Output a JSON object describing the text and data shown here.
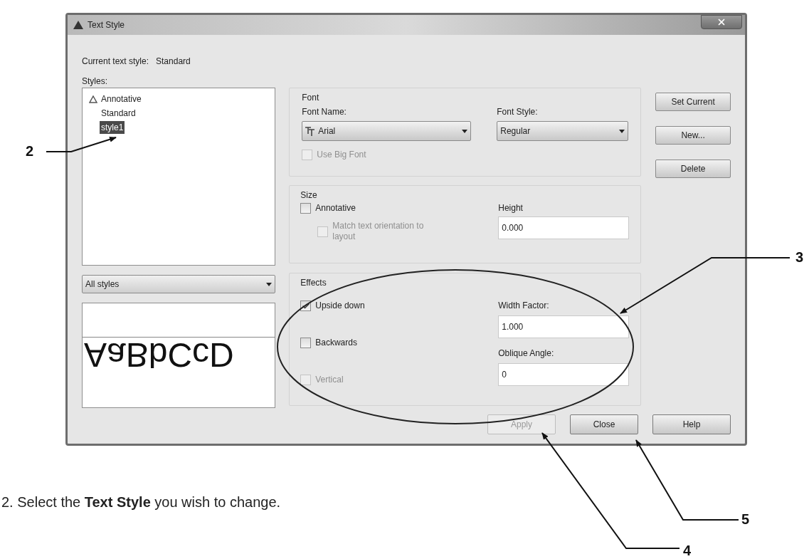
{
  "window": {
    "title": "Text Style"
  },
  "current_style": {
    "label": "Current text style:",
    "value": "Standard"
  },
  "styles": {
    "label": "Styles:",
    "items": [
      {
        "name": "Annotative",
        "annotative": true,
        "selected": false
      },
      {
        "name": "Standard",
        "annotative": false,
        "selected": false
      },
      {
        "name": "style1",
        "annotative": false,
        "selected": true
      }
    ],
    "filter": "All styles"
  },
  "preview": {
    "text": "AaBbCcD"
  },
  "font": {
    "label": "Font",
    "font_name": {
      "label": "Font Name:",
      "value": "Arial"
    },
    "font_style": {
      "label": "Font Style:",
      "value": "Regular"
    },
    "use_big_font": {
      "label": "Use Big Font",
      "checked": false,
      "disabled": true
    }
  },
  "size": {
    "label": "Size",
    "annotative": {
      "label": "Annotative",
      "checked": false,
      "disabled": false
    },
    "match_orientation": {
      "label": "Match text orientation to layout",
      "checked": false,
      "disabled": true
    },
    "height": {
      "label": "Height",
      "value": "0.000"
    }
  },
  "effects": {
    "label": "Effects",
    "upside_down": {
      "label": "Upside down",
      "checked": true,
      "disabled": false
    },
    "backwards": {
      "label": "Backwards",
      "checked": false,
      "disabled": false
    },
    "vertical": {
      "label": "Vertical",
      "checked": false,
      "disabled": true
    },
    "width_factor": {
      "label": "Width Factor:",
      "value": "1.000"
    },
    "oblique_angle": {
      "label": "Oblique Angle:",
      "value": "0"
    }
  },
  "side_buttons": [
    "Set Current",
    "New...",
    "Delete"
  ],
  "bottom_buttons": [
    {
      "label": "Apply",
      "disabled": true
    },
    {
      "label": "Close",
      "disabled": false
    },
    {
      "label": "Help",
      "disabled": false
    }
  ],
  "callouts": [
    "2",
    "3",
    "4",
    "5"
  ],
  "caption": "2. Select the **Text Style** you wish to change."
}
